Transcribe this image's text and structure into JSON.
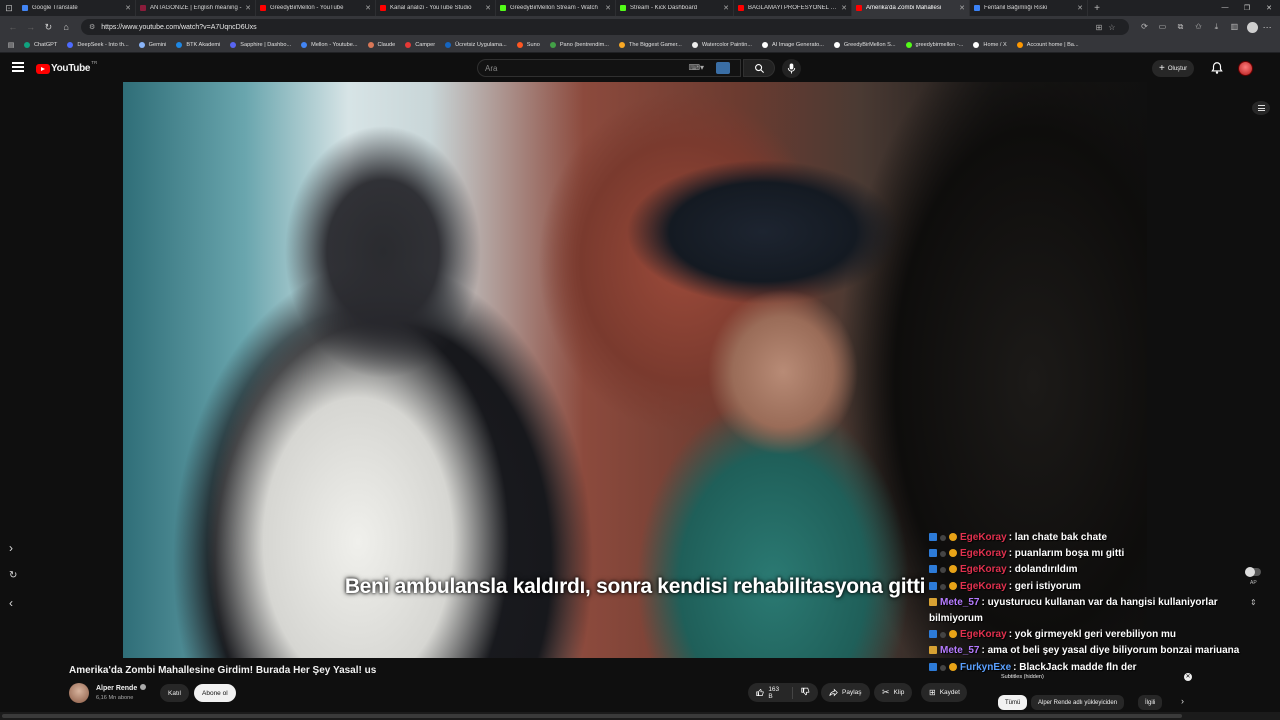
{
  "browser": {
    "tabs": [
      {
        "title": "Google Translate",
        "color": "#4285f4",
        "active": false
      },
      {
        "title": "ANTAGONIZE | English meaning -",
        "color": "#8a1c3b",
        "active": false
      },
      {
        "title": "GreedyBirMellon - YouTube",
        "color": "#ff0000",
        "active": false
      },
      {
        "title": "Kanal analizi - YouTube Studio",
        "color": "#ff0000",
        "active": false
      },
      {
        "title": "GreedyBirMellon Stream - Watch",
        "color": "#53fc18",
        "active": false
      },
      {
        "title": "Stream - Kick Dashboard",
        "color": "#53fc18",
        "active": false
      },
      {
        "title": "BAĞLAMAYI PROFESYONEL ÇALM",
        "color": "#ff0000",
        "active": false
      },
      {
        "title": "Amerika'da Zombi Mahallesi",
        "color": "#ff0000",
        "active": true
      },
      {
        "title": "Fentanil Bağımlığı Riski",
        "color": "#3b82f6",
        "active": false
      }
    ],
    "url": "https://www.youtube.com/watch?v=A7UqncD6Uxs",
    "bookmarks": [
      {
        "label": "ChatGPT",
        "color": "#10a37f"
      },
      {
        "label": "DeepSeek - Into th...",
        "color": "#4d6bfe"
      },
      {
        "label": "Gemini",
        "color": "#8ab4f8"
      },
      {
        "label": "BTK Akademi",
        "color": "#1e88e5"
      },
      {
        "label": "Sapphire | Dashbo...",
        "color": "#5865f2"
      },
      {
        "label": "Mellon - Youtube...",
        "color": "#4285f4"
      },
      {
        "label": "Claude",
        "color": "#d97757"
      },
      {
        "label": "Camper",
        "color": "#e53935"
      },
      {
        "label": "Ücretsiz Uygulama...",
        "color": "#1565c0"
      },
      {
        "label": "Suno",
        "color": "#ff5722"
      },
      {
        "label": "Pano (bentrendim...",
        "color": "#43a047"
      },
      {
        "label": "The Biggest Gamer...",
        "color": "#f9a825"
      },
      {
        "label": "Watercolor Paintin...",
        "color": "#eeeeee"
      },
      {
        "label": "AI Image Generato...",
        "color": "#ffffff"
      },
      {
        "label": "GreedyBirMellon S...",
        "color": "#ffffff"
      },
      {
        "label": "greedybirmellon -...",
        "color": "#53fc18"
      },
      {
        "label": "Home / X",
        "color": "#ffffff"
      },
      {
        "label": "Account home | Ba...",
        "color": "#ff9800"
      }
    ]
  },
  "youtube": {
    "logo_text": "YouTube",
    "country": "TR",
    "search_placeholder": "Ara",
    "create_label": "Oluştur"
  },
  "video": {
    "subtitle": "Beni ambulansla kaldırdı, sonra kendisi rehabilitasyona gitti",
    "autoplay_label": "AP"
  },
  "chat": [
    {
      "user": "EgeKoray",
      "text": ": lan chate bak chate",
      "nick_color": "red"
    },
    {
      "user": "EgeKoray",
      "text": ": puanlarım boşa mı gitti",
      "nick_color": "red"
    },
    {
      "user": "EgeKoray",
      "text": ": dolandırıldım",
      "nick_color": "red"
    },
    {
      "user": "EgeKoray",
      "text": ": geri istiyorum",
      "nick_color": "red"
    },
    {
      "user": "Mete_57",
      "text": ": uyusturucu kullanan var da hangisi kullaniyorlar bilmiyorum",
      "nick_color": "purple"
    },
    {
      "user": "EgeKoray",
      "text": ": yok girmeyekl geri verebiliyon mu",
      "nick_color": "red"
    },
    {
      "user": "Mete_57",
      "text": ": ama ot beli şey yasal diye biliyorum bonzai mariuana",
      "nick_color": "purple"
    },
    {
      "user": "FurkynExe",
      "text": ": BlackJack madde fln der",
      "nick_color": "blue"
    }
  ],
  "info": {
    "title": "Amerika'da Zombi Mahallesine Girdim! Burada Her Şey Yasal! us",
    "channel": "Alper Rende",
    "subscribers": "6,16 Mn abone",
    "join_label": "Katıl",
    "subscribe_label": "Abone ol",
    "likes": "163 B",
    "share_label": "Paylaş",
    "clip_label": "Klip",
    "save_label": "Kaydet",
    "subtitles_hidden": "Subtitles (hidden)",
    "chips": [
      "Tümü",
      "Alper Rende adlı yükleyiciden",
      "İlgili"
    ]
  }
}
